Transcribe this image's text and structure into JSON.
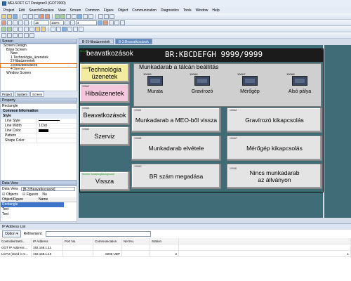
{
  "window": {
    "title": "MELSOFT GT Designer3 (GOT2000)"
  },
  "menu": [
    "Project",
    "Edit",
    "Search/Replace",
    "View",
    "Screen",
    "Common",
    "Figure",
    "Object",
    "Communication",
    "Diagnostics",
    "Tools",
    "Window",
    "Help"
  ],
  "toolbar": {
    "font_size": "16",
    "zoom": "100%",
    "value_field": "4"
  },
  "screen_panel": {
    "title": "Screen",
    "tree": [
      {
        "label": "Screen Design",
        "indent": 1
      },
      {
        "label": "Base Screen",
        "indent": 2
      },
      {
        "label": "New",
        "indent": 3
      },
      {
        "label": "1 Technológia_üzenetek",
        "indent": 3
      },
      {
        "label": "2 Hibaüzenetek",
        "indent": 3
      },
      {
        "label": "3 Beavatkozások",
        "indent": 3,
        "selected": true
      },
      {
        "label": "4 Szerviz",
        "indent": 3
      },
      {
        "label": "Window Screen",
        "indent": 2
      }
    ],
    "tabs": [
      "Project",
      "System",
      "Screen"
    ],
    "active_tab": "Screen"
  },
  "property_panel": {
    "title": "Property",
    "object_name": "Rectangle",
    "section": "Common Information",
    "style_label": "Style",
    "rows": [
      {
        "key": "Line Style",
        "value": ""
      },
      {
        "key": "Line Width",
        "value": "1 Dot"
      },
      {
        "key": "Line Color",
        "value": ""
      },
      {
        "key": "Pattern",
        "value": ""
      },
      {
        "key": "Shape Color",
        "value": ""
      }
    ]
  },
  "data_view": {
    "title": "Data View",
    "view_label": "Data View",
    "view_value": "[B-3:Beavatkozások]",
    "checks": [
      "Objects",
      "Figures",
      "Nu"
    ],
    "col_object": "Object/Figure",
    "col_name": "Name",
    "items": [
      "Rectangle",
      "Text",
      "Text"
    ]
  },
  "doc_tabs": [
    "B-2:Hibaüzenetek",
    "B-3:Beavatkozások"
  ],
  "active_doc_tab": "B-3:Beavatkozások",
  "canvas": {
    "mode_tag": "Mode",
    "header_title": "beavatkozások",
    "header_right": "BR:KBCDEFGH  9999/9999",
    "nav_buttons": [
      {
        "id": "100A1",
        "label": "Technológia üzenetek",
        "style": "yellow"
      },
      {
        "id": "100A2",
        "label": "Hibaüzenetek",
        "style": "pink"
      },
      {
        "id": "100A3",
        "label": "Beavatkozások",
        "style": "gray"
      },
      {
        "id": "100A4",
        "label": "Szerviz",
        "style": "gray"
      },
      {
        "id": "Screen SwitchingBackground",
        "label": "Vissza",
        "style": "gray"
      }
    ],
    "group_title": "Munkadarab a tálcán beállítás",
    "lamps": [
      {
        "id": "100A5",
        "label": "Murata"
      },
      {
        "id": "100A6",
        "label": "Gravírozó"
      },
      {
        "id": "100A7",
        "label": "Mérőgép"
      },
      {
        "id": "100A8",
        "label": "Alsó pálya"
      }
    ],
    "action_buttons": [
      {
        "id": "100A9",
        "label": "Munkadarab a MEO-ből vissza"
      },
      {
        "id": "100AA",
        "label": "Gravírozó kikapcsolás"
      },
      {
        "id": "100AB",
        "label": "Munkadarab elvétele"
      },
      {
        "id": "100AC",
        "label": "Mérőgép kikapcsolás"
      },
      {
        "id": "100AD",
        "label": "BR szám megadása"
      },
      {
        "id": "100AE",
        "label": "Nincs munkadarab az állványon"
      }
    ]
  },
  "ip_list": {
    "title": "IP Address List",
    "option_label": "Option",
    "refinement_label": "Refinement:",
    "columns": [
      "Controller/Setti...",
      "IP Address",
      "Port No.",
      "Communication",
      "Net No.",
      "Station",
      ""
    ],
    "rows": [
      [
        "GOT IP Address ...",
        "192.168.1.11",
        "",
        "",
        "",
        "",
        ""
      ],
      [
        "LCPU (Used in C...",
        "192.168.1.10",
        "",
        "5006 UDP",
        "",
        "2",
        "1"
      ]
    ]
  }
}
